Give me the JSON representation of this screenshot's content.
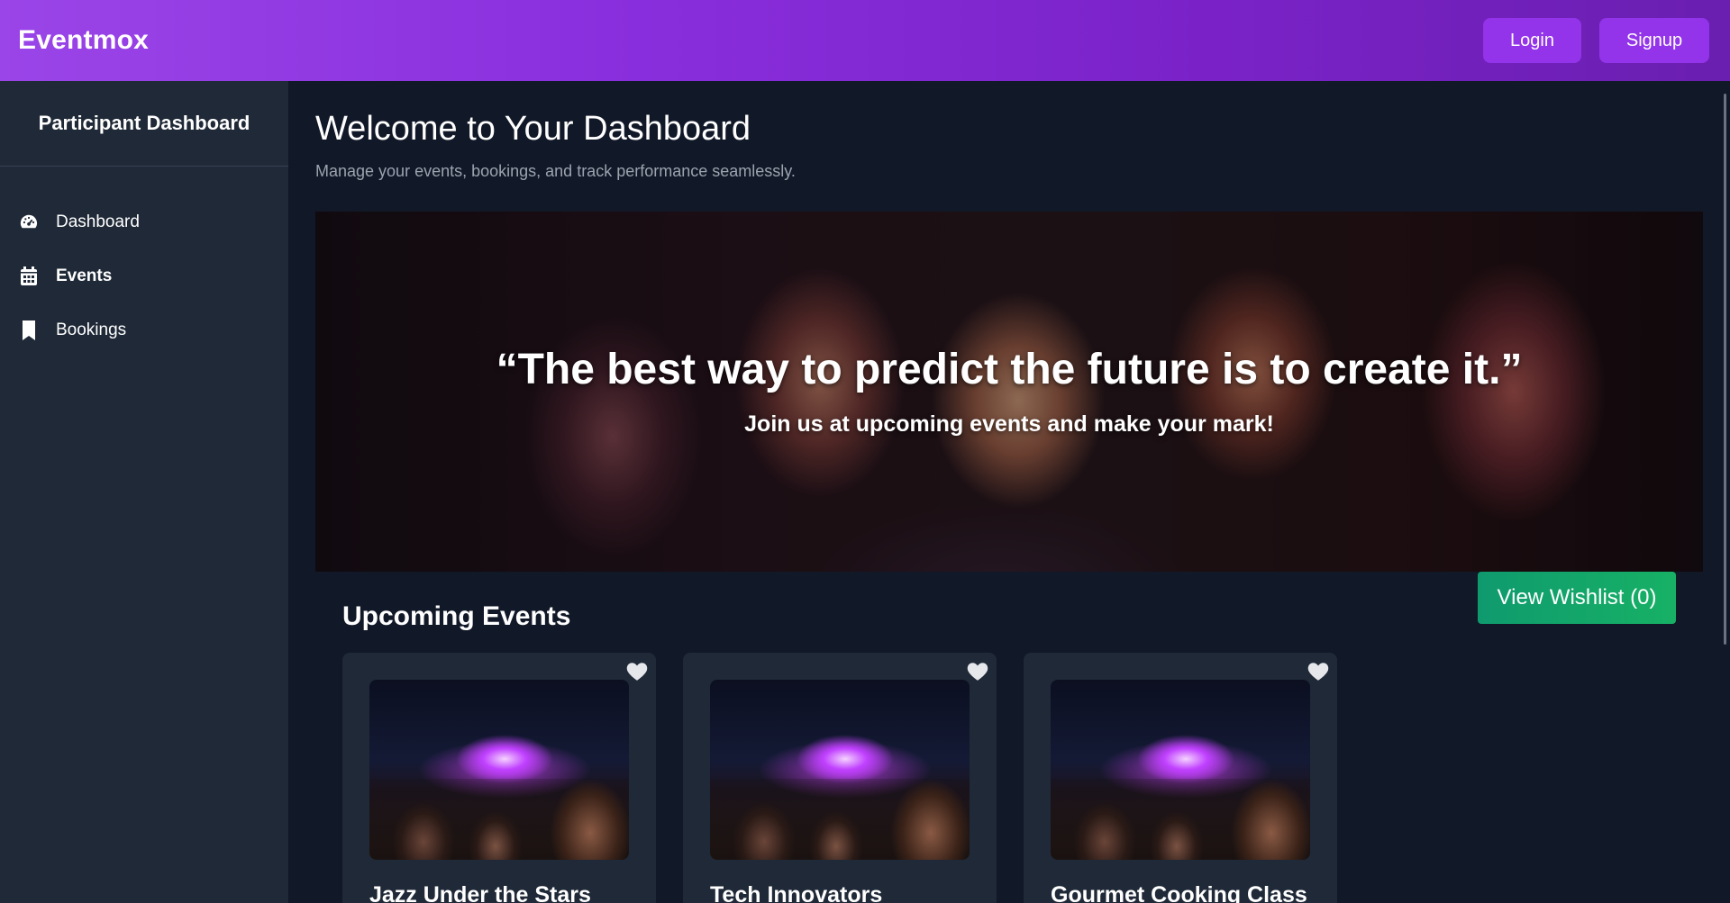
{
  "header": {
    "brand": "Eventmox",
    "login_label": "Login",
    "signup_label": "Signup"
  },
  "sidebar": {
    "title": "Participant Dashboard",
    "items": [
      {
        "label": "Dashboard",
        "icon": "gauge-icon",
        "active": false
      },
      {
        "label": "Events",
        "icon": "calendar-icon",
        "active": true
      },
      {
        "label": "Bookings",
        "icon": "bookmark-icon",
        "active": false
      }
    ]
  },
  "main": {
    "title": "Welcome to Your Dashboard",
    "subtitle": "Manage your events, bookings, and track performance seamlessly.",
    "hero": {
      "quote": "“The best way to predict the future is to create it.”",
      "cta": "Join us at upcoming events and make your mark!"
    },
    "wishlist_label": "View Wishlist (0)",
    "section_title": "Upcoming Events",
    "events": [
      {
        "title": "Jazz Under the Stars"
      },
      {
        "title": "Tech Innovators"
      },
      {
        "title": "Gourmet Cooking Class"
      }
    ]
  },
  "colors": {
    "accent": "#9333ea",
    "wishlist": "#10a36b",
    "sidebar_bg": "#1f2937",
    "main_bg": "#111827"
  }
}
